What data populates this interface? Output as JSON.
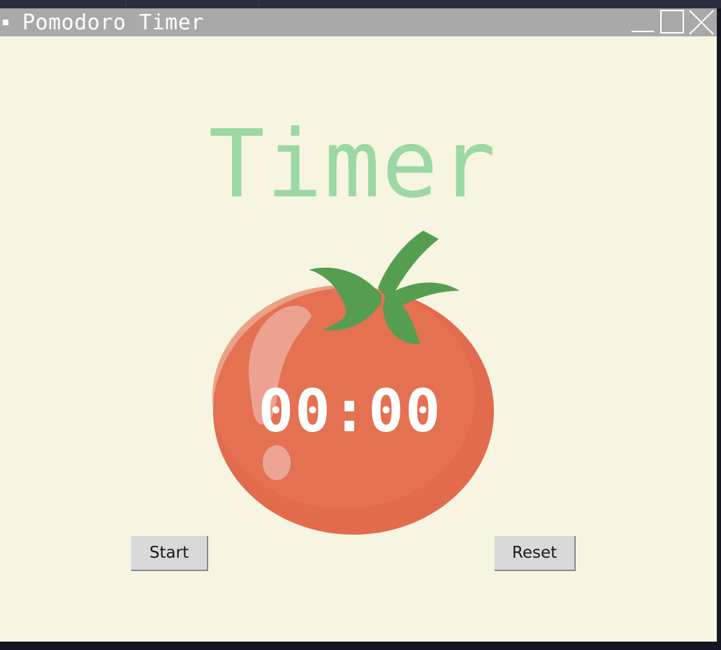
{
  "window": {
    "title": "Pomodoro Timer"
  },
  "heading": {
    "text": "Timer",
    "color": "#9bd8a3"
  },
  "timer": {
    "display": "00:00"
  },
  "controls": {
    "start_label": "Start",
    "reset_label": "Reset"
  },
  "icons": {
    "window_menu": "window-menu-icon",
    "minimize": "minimize-icon",
    "maximize": "maximize-icon",
    "close": "close-icon",
    "tomato": "tomato-icon"
  },
  "colors": {
    "background": "#f7f5e1",
    "titlebar": "#a9a9a9",
    "tomato": "#e26b4e",
    "leaves": "#559e50"
  }
}
